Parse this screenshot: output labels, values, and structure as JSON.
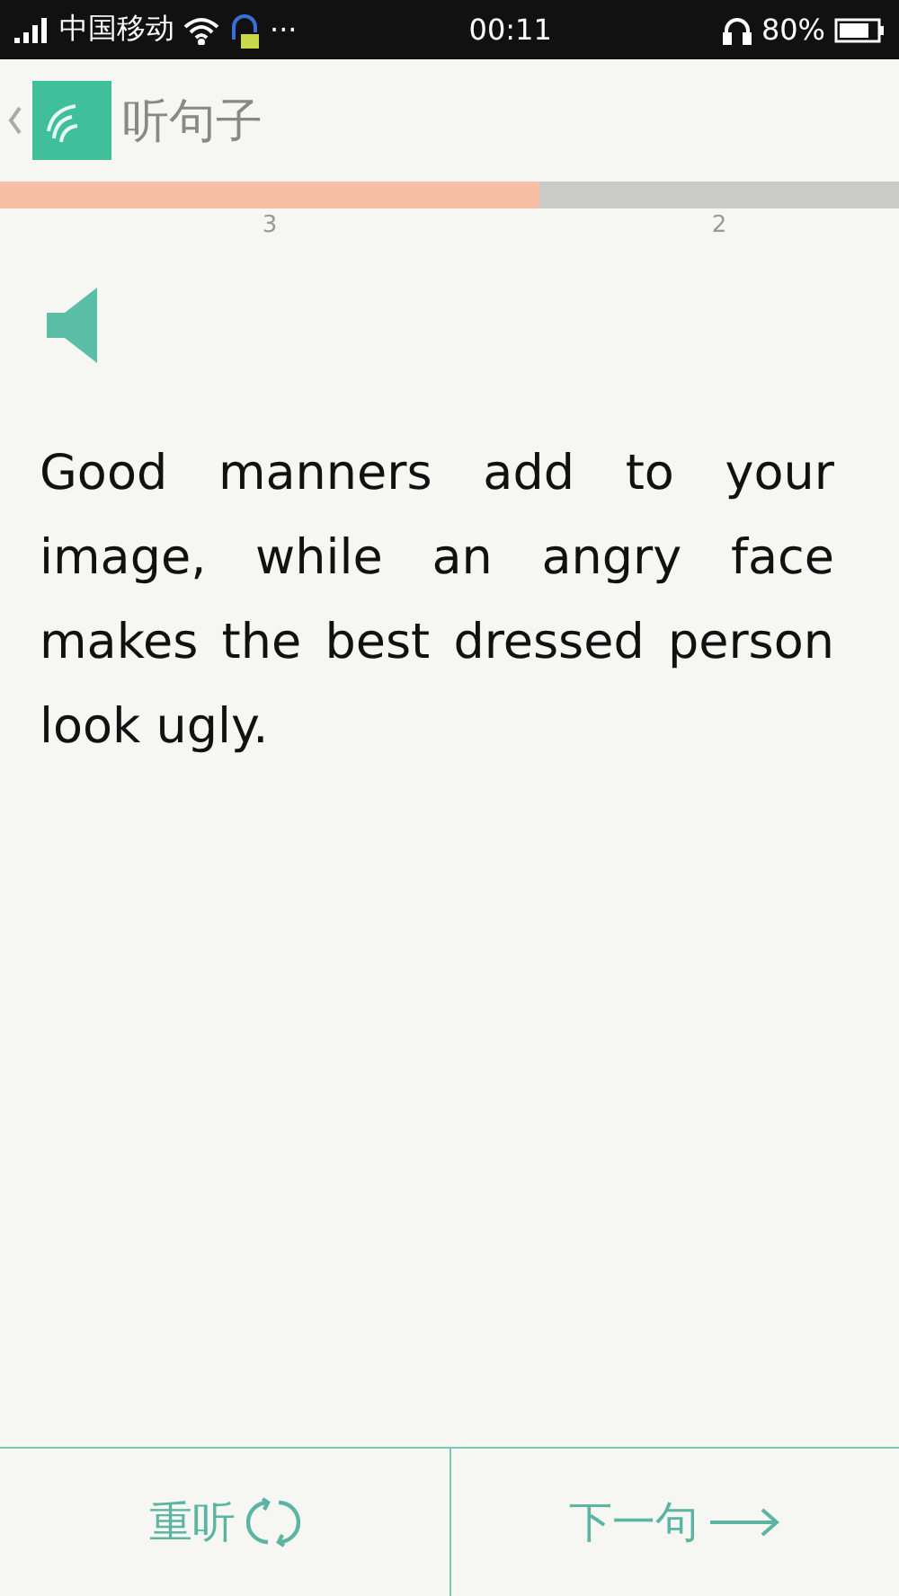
{
  "status_bar": {
    "carrier": "中国移动",
    "more": "···",
    "time": "00:11",
    "battery": "80%"
  },
  "header": {
    "title": "听句子"
  },
  "progress": {
    "level": 0.6,
    "done_label": "3",
    "remaining_label": "2"
  },
  "sentence": "Good manners add to your image, while an angry face makes the best dressed person look ugly.",
  "buttons": [
    {
      "kind": "replay",
      "label": "重听"
    },
    {
      "kind": "next",
      "label": "下一句"
    }
  ]
}
